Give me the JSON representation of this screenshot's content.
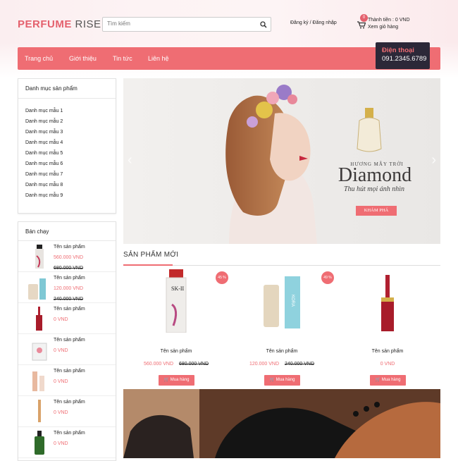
{
  "header": {
    "logo_main": "PERFUME",
    "logo_sub": "RISE",
    "search_placeholder": "Tìm kiếm",
    "register": "Đăng ký",
    "separator": "/",
    "login": "Đăng nhập",
    "cart_count": "0",
    "cart_total": "Thành tiền : 0 VND",
    "cart_view": "Xem giỏ hàng"
  },
  "nav": {
    "items": [
      "Trang chủ",
      "Giới thiệu",
      "Tin tức",
      "Liên hệ"
    ]
  },
  "phone": {
    "title": "Điện thoại",
    "number": "091.2345.6789"
  },
  "sidebar": {
    "categories_title": "Danh mục sản phẩm",
    "categories": [
      "Danh mục mẫu 1",
      "Danh mục mẫu 2",
      "Danh mục mẫu 3",
      "Danh mục mẫu 4",
      "Danh mục mẫu 5",
      "Danh mục mẫu 6",
      "Danh mục mẫu 7",
      "Danh mục mẫu 8",
      "Danh mục mẫu 9"
    ],
    "best_title": "Bán chạy",
    "best": [
      {
        "name": "Tên sản phẩm",
        "price": "560.000 VND",
        "old": "680.000 VND"
      },
      {
        "name": "Tên sản phẩm",
        "price": "120.000 VND",
        "old": "240.000 VND"
      },
      {
        "name": "Tên sản phẩm",
        "price": "0 VND",
        "old": ""
      },
      {
        "name": "Tên sản phẩm",
        "price": "0 VND",
        "old": ""
      },
      {
        "name": "Tên sản phẩm",
        "price": "0 VND",
        "old": ""
      },
      {
        "name": "Tên sản phẩm",
        "price": "0 VND",
        "old": ""
      },
      {
        "name": "Tên sản phẩm",
        "price": "0 VND",
        "old": ""
      }
    ]
  },
  "banner": {
    "tag": "HƯƠNG MÂY TRỜI",
    "title": "Diamond",
    "subtitle": "Thu hút mọi ánh nhìn",
    "cta": "KHÁM PHÁ",
    "prev": "‹",
    "next": "›"
  },
  "new_products": {
    "title": "SẢN PHẨM MỚI",
    "items": [
      {
        "name": "Tên sản phẩm",
        "price": "560.000 VND",
        "old": "680.000 VND",
        "discount": "45 %",
        "buy": "Mua hàng"
      },
      {
        "name": "Tên sản phẩm",
        "price": "120.000 VND",
        "old": "240.000 VND",
        "discount": "49 %",
        "buy": "Mua hàng"
      },
      {
        "name": "Tên sản phẩm",
        "price": "0 VND",
        "old": "",
        "discount": "",
        "buy": "Mua hàng"
      }
    ]
  },
  "colors": {
    "accent": "#ef6d73",
    "dark": "#2c2838"
  }
}
